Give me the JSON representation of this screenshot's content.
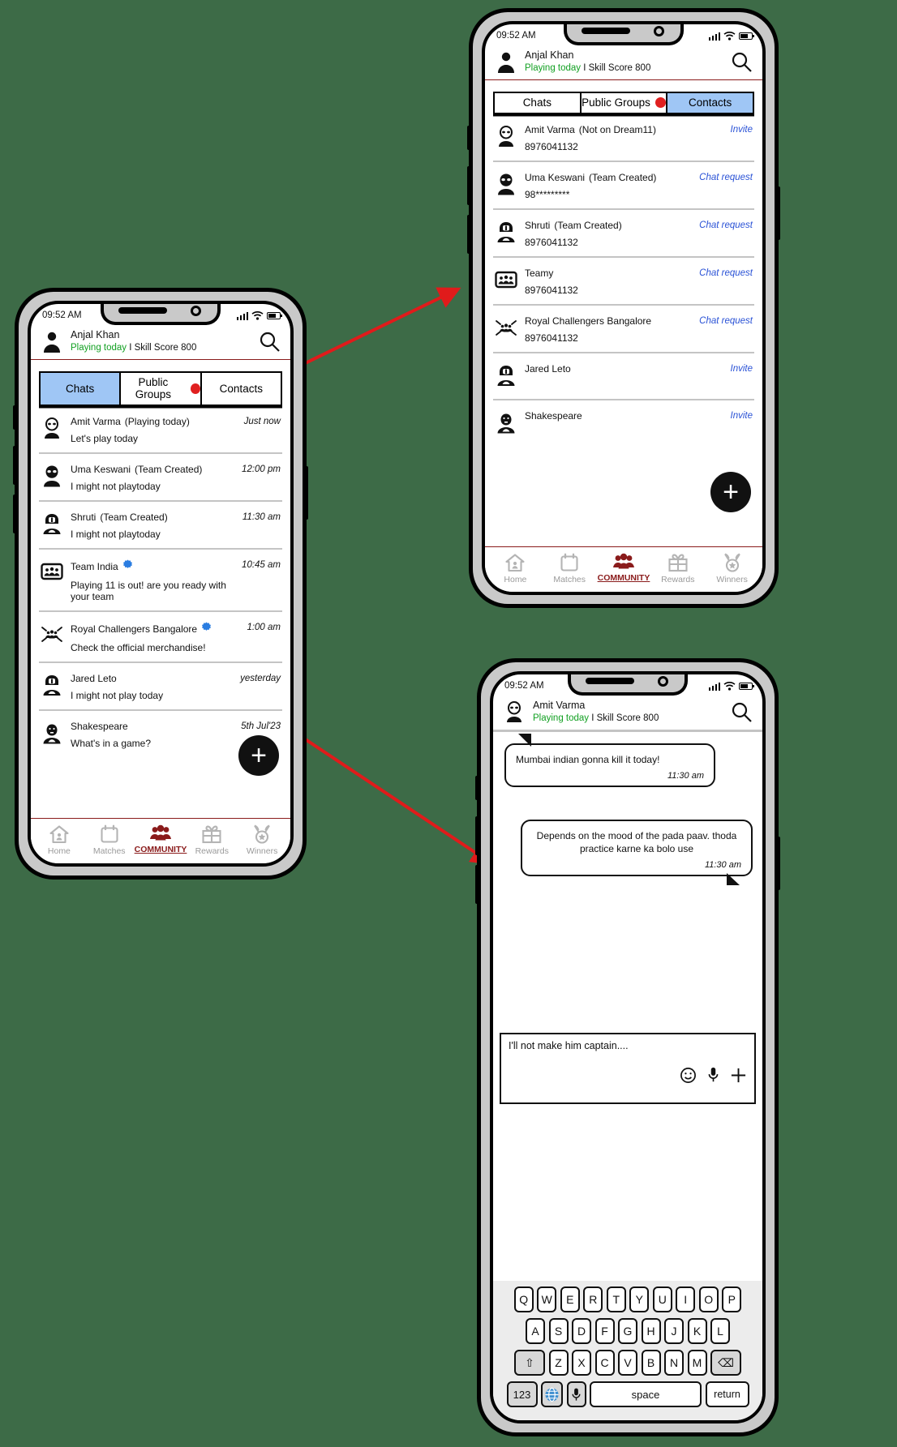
{
  "status_bar": {
    "time": "09:52 AM"
  },
  "phone1": {
    "header": {
      "name": "Anjal Khan",
      "status_green": "Playing today",
      "status_rest": " I Skill Score 800",
      "search_icon": "search-icon"
    },
    "tabs": [
      {
        "label": "Chats",
        "active": true,
        "badge": false
      },
      {
        "label": "Public Groups",
        "active": false,
        "badge": true
      },
      {
        "label": "Contacts",
        "active": false,
        "badge": false
      }
    ],
    "chats": [
      {
        "avatar": "alien-outline-avatar",
        "name": "Amit Varma",
        "tag": "(Playing today)",
        "verified": false,
        "message": "Let's play today",
        "time": "Just now"
      },
      {
        "avatar": "alien-solid-avatar",
        "name": "Uma Keswani",
        "tag": "(Team Created)",
        "verified": false,
        "message": "I might not playtoday",
        "time": "12:00 pm"
      },
      {
        "avatar": "helmet-avatar",
        "name": "Shruti",
        "tag": "(Team Created)",
        "verified": false,
        "message": "I might not playtoday",
        "time": "11:30 am"
      },
      {
        "avatar": "group-avatar",
        "name": "Team India",
        "tag": "",
        "verified": true,
        "message": "Playing 11 is out! are you ready with your team",
        "time": "10:45 am"
      },
      {
        "avatar": "rcb-avatar",
        "name": "Royal Challengers Bangalore",
        "tag": "",
        "verified": true,
        "message": "Check the official merchandise!",
        "time": "1:00 am"
      },
      {
        "avatar": "helmet-avatar",
        "name": "Jared Leto",
        "tag": "",
        "verified": false,
        "message": "I might not play today",
        "time": "yesterday"
      },
      {
        "avatar": "bard-avatar",
        "name": "Shakespeare",
        "tag": "",
        "verified": false,
        "message": "What's in a game?",
        "time": "5th Jul'23"
      }
    ],
    "fab_label": "+",
    "bottom_nav": [
      {
        "label": "Home",
        "icon": "home-icon",
        "active": false
      },
      {
        "label": "Matches",
        "icon": "calendar-icon",
        "active": false
      },
      {
        "label": "COMMUNITY",
        "icon": "community-icon",
        "active": true
      },
      {
        "label": "Rewards",
        "icon": "gift-icon",
        "active": false
      },
      {
        "label": "Winners",
        "icon": "medal-icon",
        "active": false
      }
    ]
  },
  "phone2": {
    "header": {
      "name": "Anjal Khan",
      "status_green": "Playing today",
      "status_rest": " I Skill Score 800",
      "search_icon": "search-icon"
    },
    "tabs": [
      {
        "label": "Chats",
        "active": false,
        "badge": false
      },
      {
        "label": "Public Groups",
        "active": false,
        "badge": true
      },
      {
        "label": "Contacts",
        "active": true,
        "badge": false
      }
    ],
    "contacts": [
      {
        "avatar": "alien-outline-avatar",
        "name": "Amit Varma",
        "tag": "(Not on Dream11)",
        "phone": "8976041132",
        "action": "Invite"
      },
      {
        "avatar": "alien-solid-avatar",
        "name": "Uma Keswani",
        "tag": "(Team Created)",
        "phone": "98*********",
        "action": "Chat request"
      },
      {
        "avatar": "helmet-avatar",
        "name": "Shruti",
        "tag": "(Team Created)",
        "phone": "8976041132",
        "action": "Chat request"
      },
      {
        "avatar": "group-avatar",
        "name": "Teamy",
        "tag": "",
        "phone": "8976041132",
        "action": "Chat request"
      },
      {
        "avatar": "rcb-avatar",
        "name": "Royal Challengers Bangalore",
        "tag": "",
        "phone": "8976041132",
        "action": "Chat request"
      },
      {
        "avatar": "helmet-avatar",
        "name": "Jared Leto",
        "tag": "",
        "phone": "",
        "action": "Invite"
      },
      {
        "avatar": "bard-avatar",
        "name": "Shakespeare",
        "tag": "",
        "phone": "",
        "action": "Invite"
      }
    ],
    "fab_label": "+",
    "bottom_nav": [
      {
        "label": "Home",
        "icon": "home-icon",
        "active": false
      },
      {
        "label": "Matches",
        "icon": "calendar-icon",
        "active": false
      },
      {
        "label": "COMMUNITY",
        "icon": "community-icon",
        "active": true
      },
      {
        "label": "Rewards",
        "icon": "gift-icon",
        "active": false
      },
      {
        "label": "Winners",
        "icon": "medal-icon",
        "active": false
      }
    ]
  },
  "phone3": {
    "header": {
      "name": "Amit Varma",
      "status_green": "Playing today",
      "status_rest": " I Skill Score 800",
      "search_icon": "search-icon"
    },
    "messages": [
      {
        "side": "left",
        "text": "Mumbai indian gonna kill it today!",
        "time": "11:30 am"
      },
      {
        "side": "right",
        "text": "Depends on the mood of the pada paav. thoda practice karne ka bolo use",
        "time": "11:30 am"
      }
    ],
    "composer": {
      "value": "I'll not make him captain....",
      "emoji_icon": "emoji-icon",
      "mic_icon": "mic-icon",
      "plus_icon": "plus-icon"
    },
    "keyboard": {
      "row1": [
        "Q",
        "W",
        "E",
        "R",
        "T",
        "Y",
        "U",
        "I",
        "O",
        "P"
      ],
      "row2": [
        "A",
        "S",
        "D",
        "F",
        "G",
        "H",
        "J",
        "K",
        "L"
      ],
      "row3": [
        "Z",
        "X",
        "C",
        "V",
        "B",
        "N",
        "M"
      ],
      "shift_label": "⇧",
      "backspace_label": "⌫",
      "numeric_label": "123",
      "globe_label": "🌐",
      "mic_label": "mic-icon",
      "space_label": "space",
      "return_label": "return"
    }
  },
  "colors": {
    "accent_red": "#8a1b1b",
    "green": "#12a022",
    "tab_active": "#9fc6f5",
    "badge_red": "#e02020",
    "link_blue": "#2a52d6",
    "arrow_red": "#e01b1b"
  }
}
